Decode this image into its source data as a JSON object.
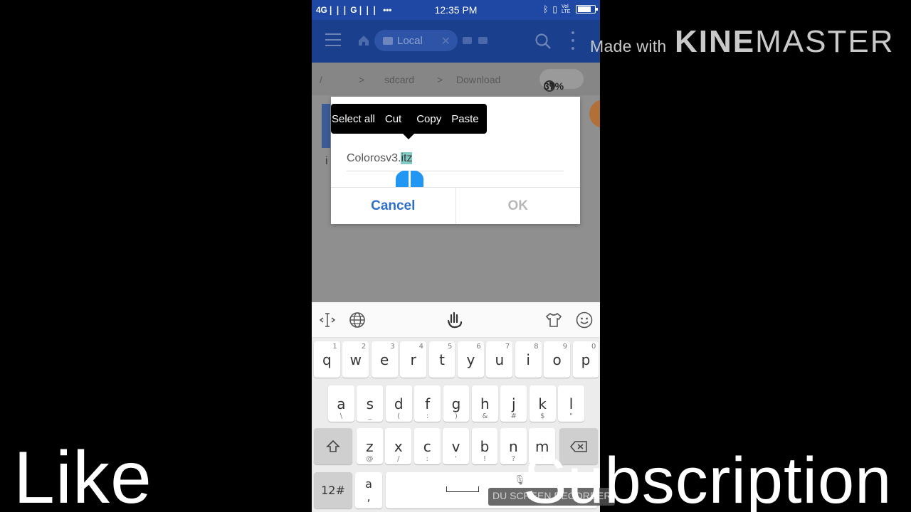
{
  "status_bar": {
    "network": "4G❘❘❘ G❘❘❘",
    "dots": "•••",
    "time": "12:35 PM",
    "lte_label": "Vol LTE"
  },
  "app_bar": {
    "tab_label": "Local",
    "icons": [
      "menu-icon",
      "home-icon",
      "search-icon",
      "more-icon"
    ]
  },
  "breadcrumb": {
    "root": "/",
    "sep": ">",
    "level1": "sdcard",
    "level2": "Download",
    "storage_used": "37%"
  },
  "list": {
    "item_letter": "i"
  },
  "dialog": {
    "filename_base": "Colorosv3.",
    "filename_selected": "itz",
    "cancel_label": "Cancel",
    "ok_label": "OK"
  },
  "context_menu": {
    "items": [
      "Select all",
      "Cut",
      "Copy",
      "Paste"
    ]
  },
  "keyboard": {
    "row1": [
      {
        "key": "q",
        "hint": "1"
      },
      {
        "key": "w",
        "hint": "2"
      },
      {
        "key": "e",
        "hint": "3"
      },
      {
        "key": "r",
        "hint": "4"
      },
      {
        "key": "t",
        "hint": "5"
      },
      {
        "key": "y",
        "hint": "6"
      },
      {
        "key": "u",
        "hint": "7"
      },
      {
        "key": "i",
        "hint": "8"
      },
      {
        "key": "o",
        "hint": "9"
      },
      {
        "key": "p",
        "hint": "0"
      }
    ],
    "row2": [
      {
        "key": "a",
        "hint": "\\"
      },
      {
        "key": "s",
        "hint": "_"
      },
      {
        "key": "d",
        "hint": "("
      },
      {
        "key": "f",
        "hint": ":"
      },
      {
        "key": "g",
        "hint": ")"
      },
      {
        "key": "h",
        "hint": "&"
      },
      {
        "key": "j",
        "hint": "#"
      },
      {
        "key": "k",
        "hint": "$"
      },
      {
        "key": "l",
        "hint": "\""
      }
    ],
    "row3": [
      {
        "key": "z",
        "hint": "@"
      },
      {
        "key": "x",
        "hint": "/"
      },
      {
        "key": "c",
        "hint": ":"
      },
      {
        "key": "v",
        "hint": "'"
      },
      {
        "key": "b",
        "hint": "!"
      },
      {
        "key": "n",
        "hint": "?"
      },
      {
        "key": "m",
        "hint": ";"
      }
    ],
    "symbols_label": "12#",
    "comma_top": "a",
    "comma_bottom": ","
  },
  "overlays": {
    "made_with": "Made with",
    "brand_bold": "KINE",
    "brand_light": "MASTER",
    "like": "Like",
    "subscription": "Subscription",
    "du_recorder": "DU SCREEN RECORDER"
  }
}
